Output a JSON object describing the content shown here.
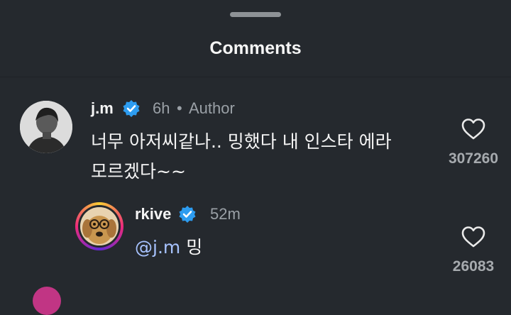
{
  "sheet": {
    "title": "Comments"
  },
  "comments": [
    {
      "username": "j.m",
      "time": "6h",
      "separator": "•",
      "badge": "Author",
      "text_line1": "너무 아저씨같나.. 밍했다 내 인스타 에라",
      "text_line2": "모르겠다~~",
      "likes": "307260"
    },
    {
      "username": "rkive",
      "time": "52m",
      "mention": "@j.m",
      "text": "밍",
      "likes": "26083"
    }
  ],
  "colors": {
    "verified": "#2d9cf0",
    "mention": "#a7c3ff",
    "background": "#25292e"
  }
}
